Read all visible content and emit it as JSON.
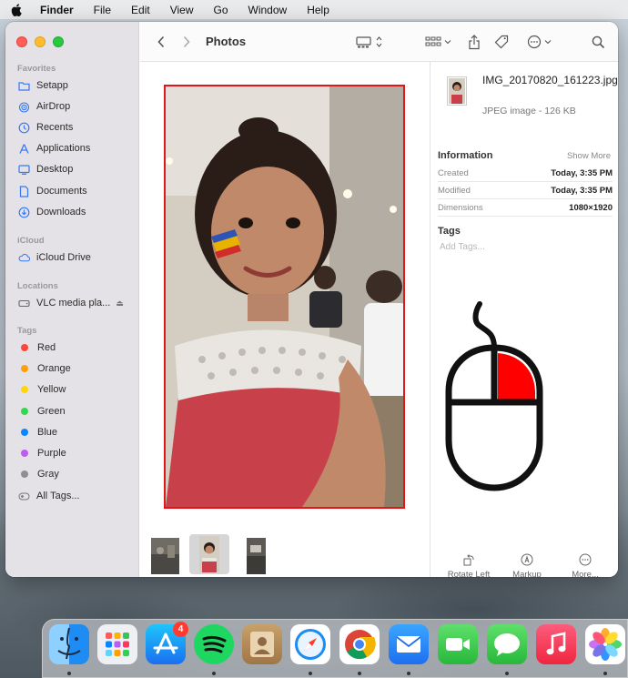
{
  "menubar": {
    "app": "Finder",
    "items": [
      "File",
      "Edit",
      "View",
      "Go",
      "Window",
      "Help"
    ]
  },
  "window": {
    "title": "Photos"
  },
  "sidebar": {
    "favorites_label": "Favorites",
    "favorites": [
      {
        "label": "Setapp",
        "icon": "folder-icon"
      },
      {
        "label": "AirDrop",
        "icon": "airdrop-icon"
      },
      {
        "label": "Recents",
        "icon": "clock-icon"
      },
      {
        "label": "Applications",
        "icon": "applications-icon"
      },
      {
        "label": "Desktop",
        "icon": "desktop-icon"
      },
      {
        "label": "Documents",
        "icon": "document-icon"
      },
      {
        "label": "Downloads",
        "icon": "download-icon"
      }
    ],
    "icloud_label": "iCloud",
    "icloud": [
      {
        "label": "iCloud Drive",
        "icon": "cloud-icon"
      }
    ],
    "locations_label": "Locations",
    "locations": [
      {
        "label": "VLC media pla...",
        "icon": "disk-icon"
      }
    ],
    "tags_label": "Tags",
    "tags": [
      {
        "label": "Red",
        "color": "#ff453a"
      },
      {
        "label": "Orange",
        "color": "#ff9f0a"
      },
      {
        "label": "Yellow",
        "color": "#ffd60a"
      },
      {
        "label": "Green",
        "color": "#32d74b"
      },
      {
        "label": "Blue",
        "color": "#0a84ff"
      },
      {
        "label": "Purple",
        "color": "#bf5af2"
      },
      {
        "label": "Gray",
        "color": "#8e8e93"
      }
    ],
    "all_tags": "All Tags..."
  },
  "inspector": {
    "filename": "IMG_20170820_161223.jpg",
    "filetype": "JPEG image - 126 KB",
    "information_label": "Information",
    "show_more": "Show More",
    "rows": [
      {
        "key": "Created",
        "value": "Today, 3:35 PM"
      },
      {
        "key": "Modified",
        "value": "Today, 3:35 PM"
      },
      {
        "key": "Dimensions",
        "value": "1080×1920"
      }
    ],
    "tags_label": "Tags",
    "tags_placeholder": "Add Tags...",
    "actions": [
      {
        "label": "Rotate Left",
        "icon": "rotate-left-icon"
      },
      {
        "label": "Markup",
        "icon": "markup-icon"
      },
      {
        "label": "More...",
        "icon": "more-icon"
      }
    ]
  },
  "dock": {
    "badge": "4",
    "apps": [
      "Finder",
      "Launchpad",
      "App Store",
      "Spotify",
      "Contacts",
      "Safari",
      "Chrome",
      "Mail",
      "FaceTime",
      "Messages",
      "Music",
      "Photos"
    ]
  },
  "colors": {
    "selection_border": "#e0161b",
    "mouse_highlight": "#ff0000"
  }
}
